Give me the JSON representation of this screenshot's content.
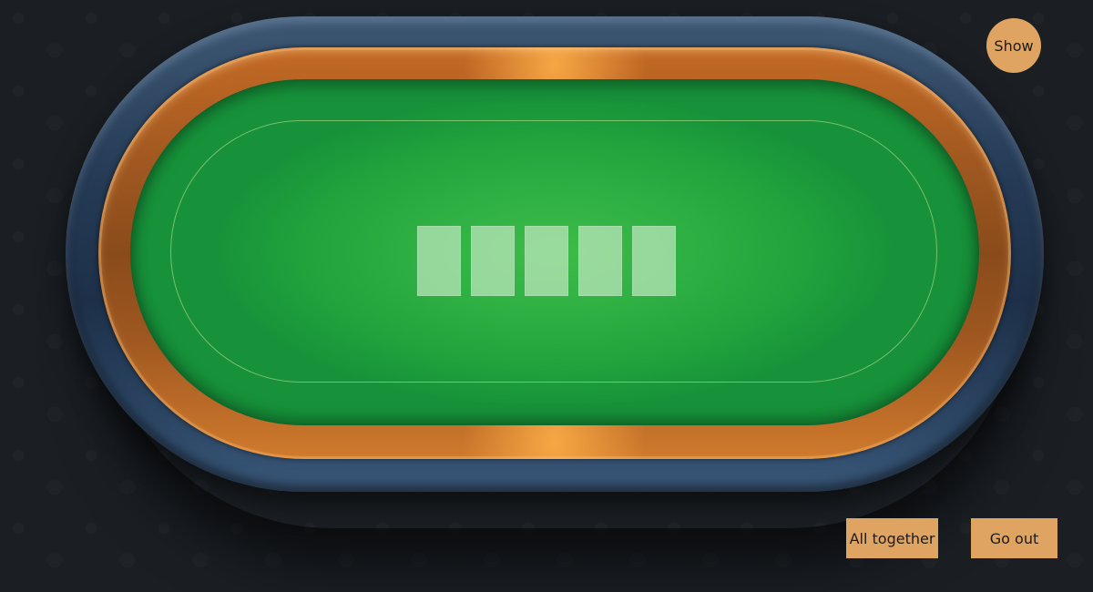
{
  "table": {
    "felt_color": "#2fb043",
    "rail_color": "#c46a25",
    "cushion_color": "#2a425f"
  },
  "community_cards": [
    {
      "state": "empty"
    },
    {
      "state": "empty"
    },
    {
      "state": "empty"
    },
    {
      "state": "empty"
    },
    {
      "state": "empty"
    }
  ],
  "controls": {
    "show_label": "Show",
    "all_together_label": "All together",
    "go_out_label": "Go out",
    "button_color": "#dfa462"
  }
}
